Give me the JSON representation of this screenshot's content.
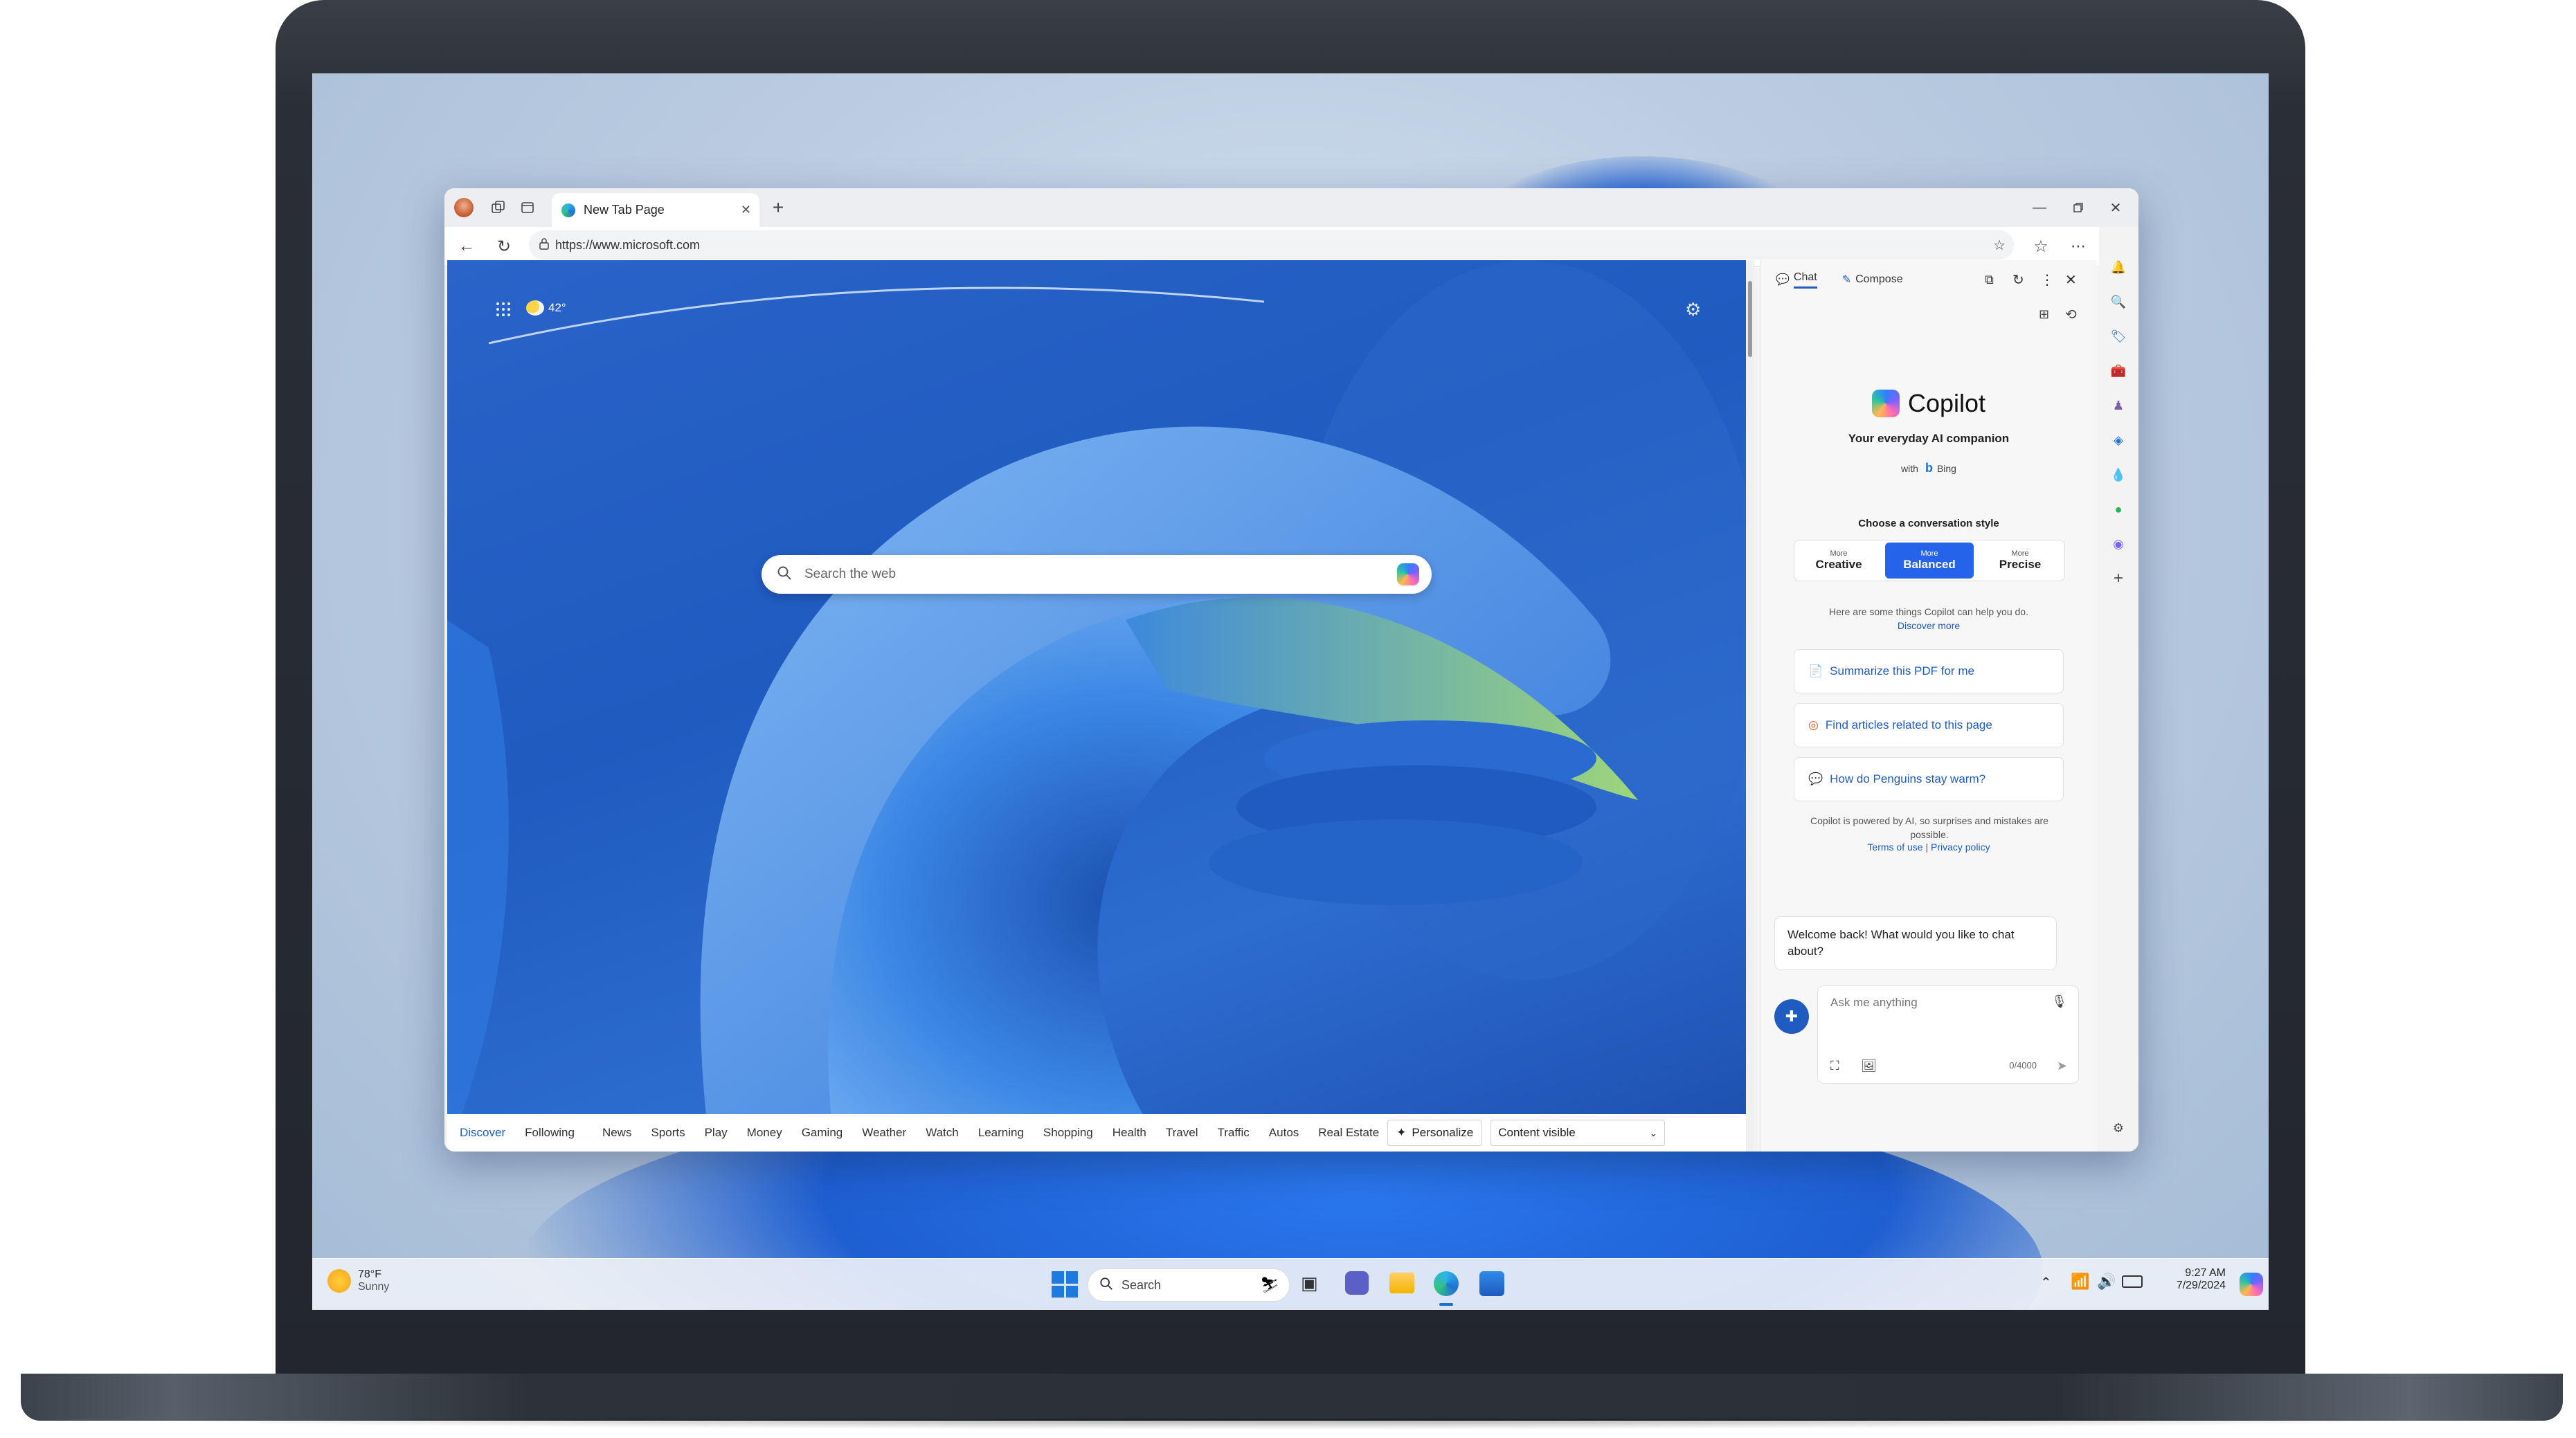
{
  "browser": {
    "tab_title": "New Tab Page",
    "url": "https://www.microsoft.com"
  },
  "newtab": {
    "weather_temp": "42°",
    "search_placeholder": "Search the web",
    "categories": [
      "Discover",
      "Following",
      "News",
      "Sports",
      "Play",
      "Money",
      "Gaming",
      "Weather",
      "Watch",
      "Learning",
      "Shopping",
      "Health",
      "Travel",
      "Traffic",
      "Autos",
      "Real Estate"
    ],
    "personalize_label": "Personalize",
    "content_visibility": "Content visible"
  },
  "copilot": {
    "tabs": [
      "Chat",
      "Compose"
    ],
    "title": "Copilot",
    "subtitle": "Your everyday AI companion",
    "with_label": "with",
    "bing_label": "Bing",
    "style_prompt": "Choose a conversation style",
    "styles": [
      {
        "small": "More",
        "big": "Creative"
      },
      {
        "small": "More",
        "big": "Balanced"
      },
      {
        "small": "More",
        "big": "Precise"
      }
    ],
    "help_text": "Here are some things Copilot can help you do.",
    "discover_more": "Discover more",
    "suggestions": [
      "Summarize this PDF for me",
      "Find articles related to this page",
      "How do Penguins stay warm?"
    ],
    "disclaimer": "Copilot is powered by AI, so surprises and mistakes are possible.",
    "terms": "Terms of use",
    "separator": "|",
    "privacy": "Privacy policy",
    "welcome": "Welcome back! What would you like to chat about?",
    "input_placeholder": "Ask me anything",
    "char_count": "0/4000"
  },
  "taskbar": {
    "weather_temp": "78°F",
    "weather_cond": "Sunny",
    "search_label": "Search",
    "time": "9:27 AM",
    "date": "7/29/2024"
  },
  "colors": {
    "accent": "#2563eb",
    "link": "#1f5bc0",
    "wallpaper": "#bccde2"
  }
}
